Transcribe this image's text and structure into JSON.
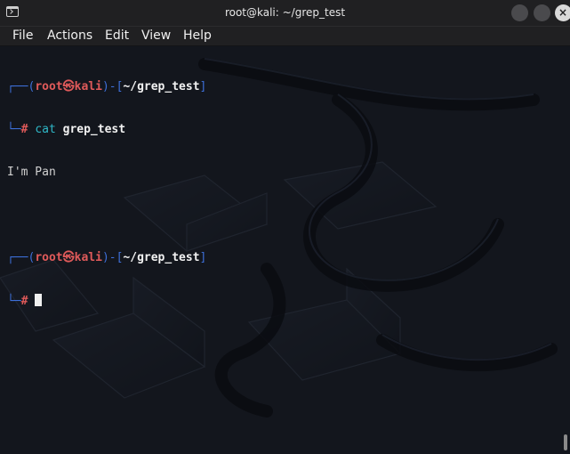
{
  "window": {
    "title": "root@kali: ~/grep_test",
    "icons": {
      "app": "terminal-icon",
      "minimize": "minimize-icon",
      "maximize": "maximize-icon",
      "close": "close-icon"
    },
    "close_glyph": "×"
  },
  "menu": {
    "file": "File",
    "actions": "Actions",
    "edit": "Edit",
    "view": "View",
    "help": "Help"
  },
  "terminal": {
    "prompt1": {
      "corner_top": "┌──(",
      "user": "root㉿kali",
      "mid": ")-[",
      "path": "~/grep_test",
      "close": "]",
      "corner_bottom": "└─",
      "hash": "#",
      "command": "cat",
      "argument": "grep_test"
    },
    "output": "I'm Pan",
    "prompt2": {
      "corner_top": "┌──(",
      "user": "root㉿kali",
      "mid": ")-[",
      "path": "~/grep_test",
      "close": "]",
      "corner_bottom": "└─",
      "hash": "#"
    },
    "colors": {
      "prompt_frame": "#3d6fd8",
      "user_host": "#e05a5a",
      "command": "#2fb8c8",
      "background": "#13161d"
    }
  }
}
